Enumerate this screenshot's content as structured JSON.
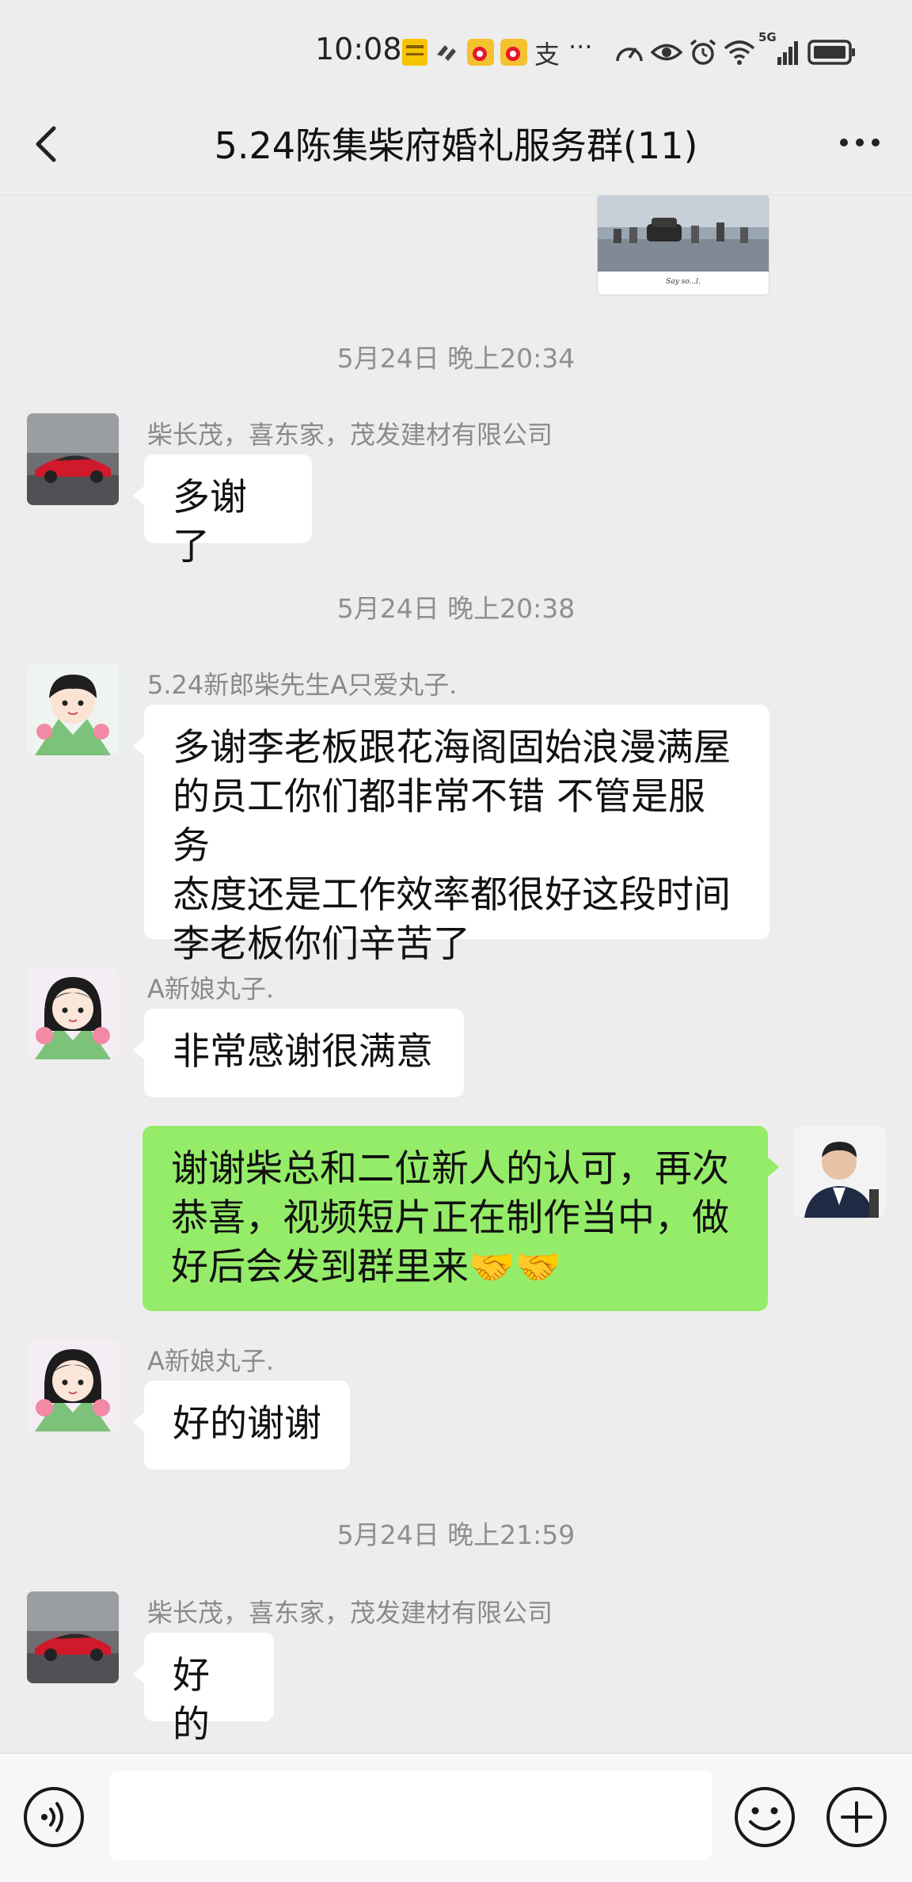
{
  "status_bar": {
    "time": "10:08",
    "network": "5G",
    "misc_glyph": "支",
    "more_notifications": "···"
  },
  "header": {
    "title": "5.24陈集柴府婚礼服务群(11)",
    "icons": {
      "back": "chevron-left-icon",
      "more": "more-dots-icon"
    }
  },
  "messages": [
    {
      "type": "image",
      "caption": "Say so...l."
    },
    {
      "type": "time",
      "text": "5月24日 晚上20:34"
    },
    {
      "type": "text",
      "side": "left",
      "sender": "柴长茂，喜东家，茂发建材有限公司",
      "avatar": "red-sports-car",
      "text": "多谢了"
    },
    {
      "type": "time",
      "text": "5月24日 晚上20:38"
    },
    {
      "type": "text",
      "side": "left",
      "sender": "5.24新郎柴先生A只爱丸子.",
      "avatar": "cartoon-boy-with-tulips",
      "lines": [
        "多谢李老板跟花海阁固始浪漫满屋",
        "的员工你们都非常不错 不管是服务",
        "态度还是工作效率都很好这段时间",
        "李老板你们辛苦了"
      ]
    },
    {
      "type": "text",
      "side": "left",
      "sender": "A新娘丸子.",
      "avatar": "cartoon-girl-with-tulips",
      "text": "非常感谢很满意"
    },
    {
      "type": "text",
      "side": "right",
      "avatar": "man-in-suit",
      "lines": [
        "谢谢柴总和二位新人的认可，再次",
        "恭喜，视频短片正在制作当中，做",
        "好后会发到群里来🤝🤝"
      ]
    },
    {
      "type": "text",
      "side": "left",
      "sender": "A新娘丸子.",
      "avatar": "cartoon-girl-with-tulips",
      "text": "好的谢谢"
    },
    {
      "type": "time",
      "text": "5月24日 晚上21:59"
    },
    {
      "type": "text",
      "side": "left",
      "sender": "柴长茂，喜东家，茂发建材有限公司",
      "avatar": "red-sports-car",
      "text": "好的"
    }
  ],
  "input_bar": {
    "placeholder": "",
    "icons": {
      "voice": "voice-icon",
      "emoji": "emoji-icon",
      "plus": "plus-icon"
    }
  },
  "colors": {
    "background": "#ededed",
    "my_bubble": "#95ec69",
    "their_bubble": "#ffffff",
    "meta_text": "#8a8a8a"
  }
}
